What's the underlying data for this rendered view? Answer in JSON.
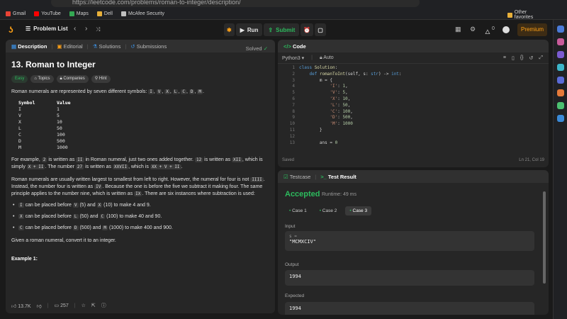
{
  "browser": {
    "url": "https://leetcode.com/problems/roman-to-integer/description/",
    "bookmarks": [
      {
        "label": "Gmail",
        "color": "#ea4335"
      },
      {
        "label": "YouTube",
        "color": "#ff0000"
      },
      {
        "label": "Maps",
        "color": "#34a853"
      },
      {
        "label": "Dell",
        "color": "#e8b03a"
      },
      {
        "label": "McAfee Security",
        "color": "#c0c0c0"
      }
    ],
    "other_favorites": "Other favorites"
  },
  "nav": {
    "problem_list": "Problem List",
    "run": "Run",
    "submit": "Submit",
    "streak": "0",
    "premium": "Premium"
  },
  "description": {
    "tabs": [
      "Description",
      "Editorial",
      "Solutions",
      "Submissions"
    ],
    "title": "13. Roman to Integer",
    "solved": "Solved",
    "tags": [
      "Easy",
      "Topics",
      "Companies",
      "Hint"
    ],
    "intro_pre": "Roman numerals are represented by seven different symbols: ",
    "intro_symbols": [
      "I",
      "V",
      "X",
      "L",
      "C",
      "D",
      "M"
    ],
    "intro_post": ".",
    "table_headers": [
      "Symbol",
      "Value"
    ],
    "table_rows": [
      [
        "I",
        "1"
      ],
      [
        "V",
        "5"
      ],
      [
        "X",
        "10"
      ],
      [
        "L",
        "50"
      ],
      [
        "C",
        "100"
      ],
      [
        "D",
        "500"
      ],
      [
        "M",
        "1000"
      ]
    ],
    "para2": {
      "a": "For example, ",
      "b": "2",
      "c": " is written as ",
      "d": "II",
      "e": " in Roman numeral, just two ones added together. ",
      "f": "12",
      "g": " is written as ",
      "h": "XII",
      "i": ", which is simply ",
      "j": "X + II",
      "k": ". The number ",
      "l": "27",
      "m": " is written as ",
      "n": "XXVII",
      "o": ", which is ",
      "p": "XX + V + II",
      "q": "."
    },
    "para3": {
      "a": "Roman numerals are usually written largest to smallest from left to right. However, the numeral for four is not ",
      "b": "IIII",
      "c": ". Instead, the number four is written as ",
      "d": "IV",
      "e": ". Because the one is before the five we subtract it making four. The same principle applies to the number nine, which is written as ",
      "f": "IX",
      "g": ". There are six instances where subtraction is used:"
    },
    "bullets": [
      {
        "s1": "I",
        "t1": " can be placed before ",
        "s2": "V",
        "t2": " (5) and ",
        "s3": "X",
        "t3": " (10) to make 4 and 9."
      },
      {
        "s1": "X",
        "t1": " can be placed before ",
        "s2": "L",
        "t2": " (50) and ",
        "s3": "C",
        "t3": " (100) to make 40 and 90."
      },
      {
        "s1": "C",
        "t1": " can be placed before ",
        "s2": "D",
        "t2": " (500) and ",
        "s3": "M",
        "t3": " (1000) to make 400 and 900."
      }
    ],
    "final": "Given a roman numeral, convert it to an integer.",
    "example": "Example 1:",
    "likes": "13.7K",
    "comments": "257"
  },
  "code": {
    "tab": "Code",
    "language": "Python3",
    "auto": "Auto",
    "lines": [
      {
        "n": "1",
        "html": "<span class='kw'>class</span> <span class='fn'>Solution</span>:"
      },
      {
        "n": "2",
        "html": "    <span class='kw'>def</span> <span class='fn'>romanToInt</span>(self, s: <span class='kw'>str</span>) -> <span class='kw'>int</span>:"
      },
      {
        "n": "3",
        "html": "        m = {"
      },
      {
        "n": "4",
        "html": "            <span class='st'>'I'</span>: <span class='nm'>1</span>,"
      },
      {
        "n": "5",
        "html": "            <span class='st'>'V'</span>: <span class='nm'>5</span>,"
      },
      {
        "n": "6",
        "html": "            <span class='st'>'X'</span>: <span class='nm'>10</span>,"
      },
      {
        "n": "7",
        "html": "            <span class='st'>'L'</span>: <span class='nm'>50</span>,"
      },
      {
        "n": "8",
        "html": "            <span class='st'>'C'</span>: <span class='nm'>100</span>,"
      },
      {
        "n": "9",
        "html": "            <span class='st'>'D'</span>: <span class='nm'>500</span>,"
      },
      {
        "n": "10",
        "html": "            <span class='st'>'M'</span>: <span class='nm'>1000</span>"
      },
      {
        "n": "11",
        "html": "        }"
      },
      {
        "n": "12",
        "html": ""
      },
      {
        "n": "13",
        "html": "        ans = <span class='nm'>0</span>"
      }
    ],
    "saved": "Saved",
    "cursor": "Ln 21, Col 19"
  },
  "result": {
    "tabs": [
      "Testcase",
      "Test Result"
    ],
    "status": "Accepted",
    "runtime": "Runtime: 49 ms",
    "cases": [
      "Case 1",
      "Case 2",
      "Case 3"
    ],
    "input_label": "Input",
    "input_var": "s =",
    "input_value": "\"MCMXCIV\"",
    "output_label": "Output",
    "output_value": "1994",
    "expected_label": "Expected",
    "expected_value": "1994"
  }
}
